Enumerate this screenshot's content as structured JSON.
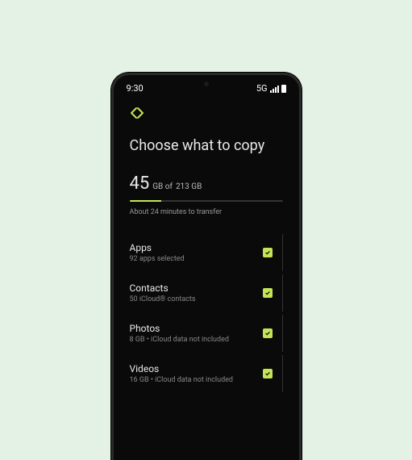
{
  "statusBar": {
    "time": "9:30",
    "network": "5G"
  },
  "screen": {
    "title": "Choose what to copy",
    "storage": {
      "used": "45",
      "usedUnit": "GB of",
      "total": "213 GB",
      "progressPercent": 21
    },
    "timeEstimate": "About 24 minutes to transfer",
    "items": [
      {
        "title": "Apps",
        "subtitle": "92 apps selected",
        "checked": true
      },
      {
        "title": "Contacts",
        "subtitle": "50 iCloud® contacts",
        "checked": true
      },
      {
        "title": "Photos",
        "subtitle": "8 GB • iCloud data not included",
        "checked": true
      },
      {
        "title": "Videos",
        "subtitle": "16 GB • iCloud data not included",
        "checked": true
      }
    ]
  },
  "colors": {
    "accent": "#c4e456",
    "background": "#0a0a0a",
    "pageBackground": "#e3f2e5"
  }
}
